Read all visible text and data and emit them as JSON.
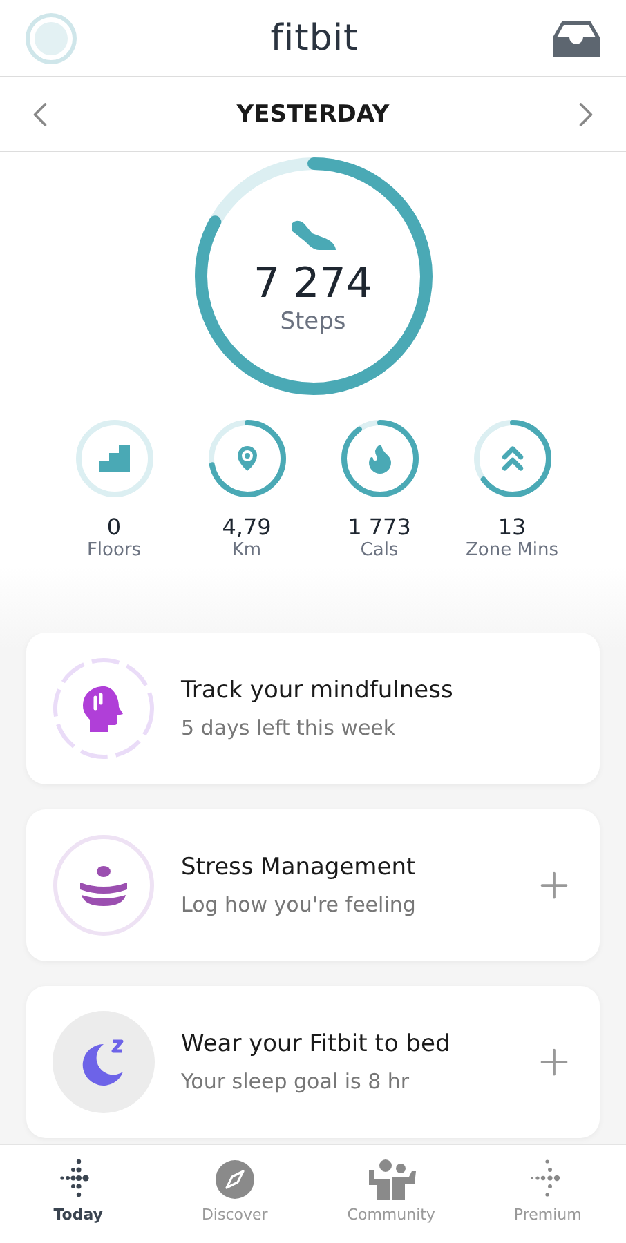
{
  "header": {
    "logo": "fitbit"
  },
  "date_nav": {
    "label": "YESTERDAY"
  },
  "steps": {
    "value": "7 274",
    "label": "Steps"
  },
  "stats": [
    {
      "kind": "floors",
      "value": "0",
      "label": "Floors"
    },
    {
      "kind": "distance",
      "value": "4,79",
      "label": "Km"
    },
    {
      "kind": "calories",
      "value": "1 773",
      "label": "Cals"
    },
    {
      "kind": "zone",
      "value": "13",
      "label": "Zone Mins"
    }
  ],
  "cards": [
    {
      "kind": "mindfulness",
      "title": "Track your mindfulness",
      "subtitle": "5 days left this week",
      "add_button": false
    },
    {
      "kind": "stress",
      "title": "Stress Management",
      "subtitle": "Log how you're feeling",
      "add_button": true
    },
    {
      "kind": "sleep",
      "title": "Wear your Fitbit to bed",
      "subtitle": "Your sleep goal is 8 hr",
      "add_button": true
    }
  ],
  "tabs": [
    {
      "kind": "today",
      "label": "Today",
      "selected": true
    },
    {
      "kind": "discover",
      "label": "Discover",
      "selected": false
    },
    {
      "kind": "community",
      "label": "Community",
      "selected": false
    },
    {
      "kind": "premium",
      "label": "Premium",
      "selected": false
    }
  ]
}
